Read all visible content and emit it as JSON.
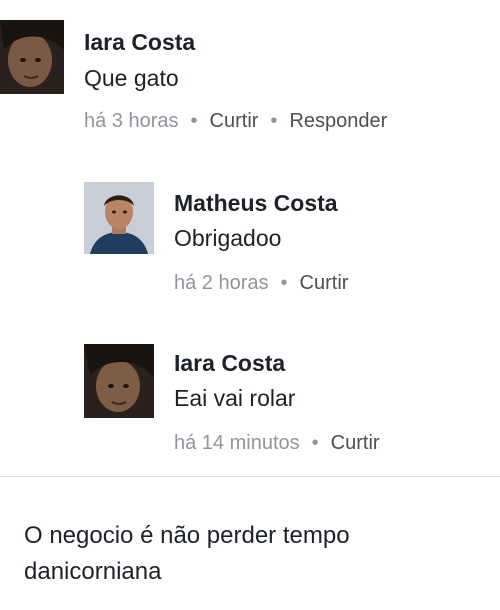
{
  "comments": [
    {
      "author": "Iara Costa",
      "text": "Que gato",
      "time": "há 3 horas",
      "actions": [
        "Curtir",
        "Responder"
      ]
    },
    {
      "author": "Matheus Costa",
      "text": "Obrigadoo",
      "time": "há 2 horas",
      "actions": [
        "Curtir"
      ]
    },
    {
      "author": "Iara Costa",
      "text": "Eai vai rolar",
      "time": "há 14 minutos",
      "actions": [
        "Curtir"
      ]
    }
  ],
  "separator": "•",
  "caption": "O negocio é não perder tempo danicorniana",
  "colors": {
    "name": "#1d2129",
    "meta": "#90949c",
    "link": "#4b4f56"
  }
}
